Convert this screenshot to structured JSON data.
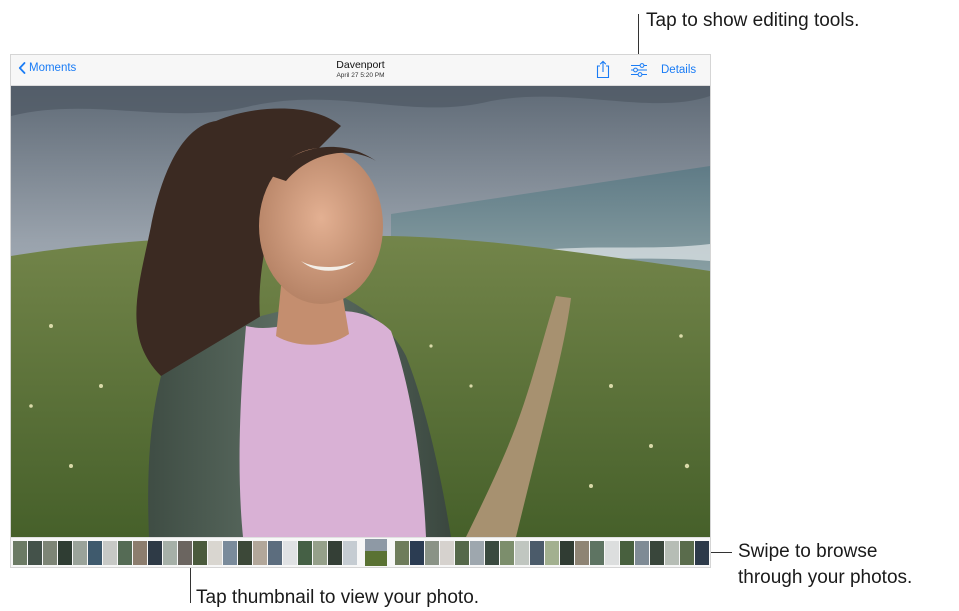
{
  "callouts": {
    "edit": "Tap to show editing tools.",
    "thumb": "Tap thumbnail to view your photo.",
    "swipe_line1": "Swipe to browse",
    "swipe_line2": "through your photos."
  },
  "navbar": {
    "back_label": "Moments",
    "title": "Davenport",
    "subtitle": "April 27  5:20 PM",
    "details_label": "Details",
    "share_icon": "share-icon",
    "edit_icon": "edit-sliders-icon"
  },
  "colors": {
    "accent": "#1a7cf5",
    "sky": "#8e99a5",
    "grass": "#5a7233",
    "jacket": "#4e5e54",
    "shirt": "#dcb3d8",
    "hair": "#3b2a22"
  },
  "thumbnail_colors": [
    "#6b7a64",
    "#44524a",
    "#7d8576",
    "#2f3d33",
    "#9aa39a",
    "#3f5a6d",
    "#c7c9c6",
    "#556b55",
    "#8c7d6e",
    "#2e3a46",
    "#a6b0a8",
    "#6b6560",
    "#4a5a3c",
    "#d9d6d0",
    "#7a8b9b",
    "#3c4838",
    "#b2a79a",
    "#5c6d7e",
    "#e0e2e4",
    "#456045",
    "#95a08a",
    "#343f36",
    "#c5ccd2",
    "#6e7c5b",
    "#2b3c52",
    "#8a9386",
    "#d6d2ce",
    "#55684a",
    "#9ea7ae",
    "#3a4a3f",
    "#7c8e6c",
    "#c0c6c0",
    "#4b5b6a",
    "#a2b08f",
    "#303c33",
    "#8e8474",
    "#5e7462",
    "#dcdede",
    "#48603e",
    "#7f8b95",
    "#39463b",
    "#b6bdb5",
    "#5a6c4c",
    "#2d3a4a",
    "#99a38c",
    "#6a7868",
    "#c9ced0",
    "#44553f"
  ]
}
